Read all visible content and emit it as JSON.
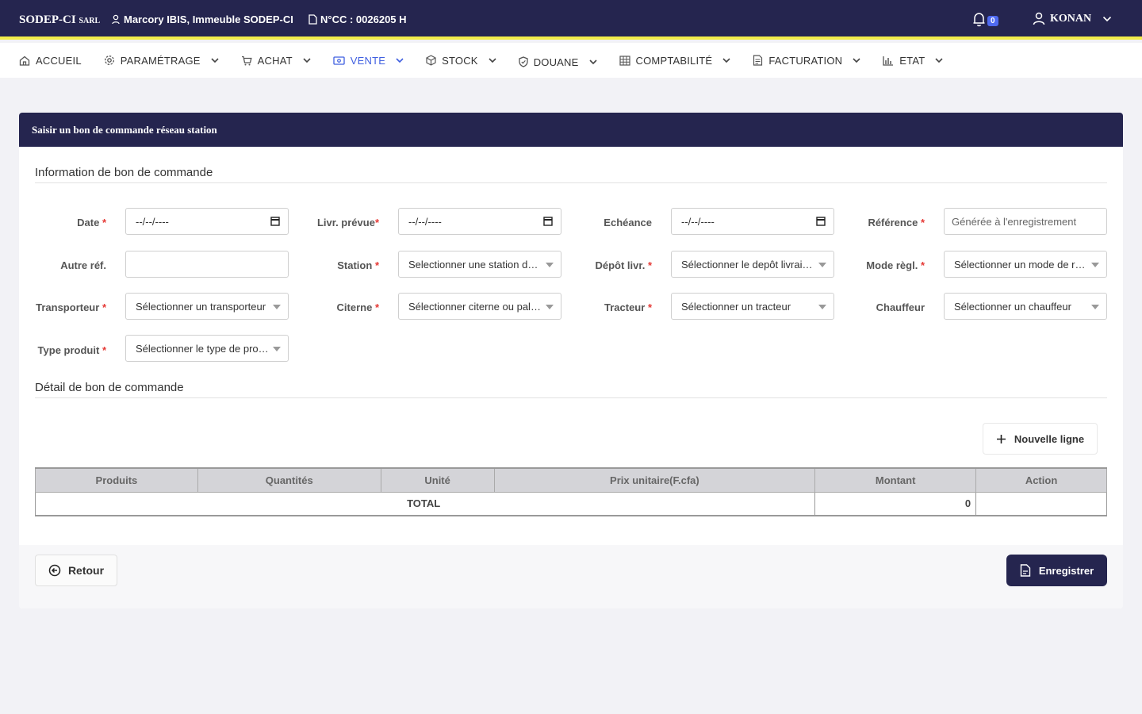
{
  "topbar": {
    "brand": "SODEP-CI",
    "brand_suffix": "SARL",
    "address": "Marcory IBIS, Immeuble SODEP-CI",
    "ncc": "N°CC : 0026205 H",
    "notifications_count": "0",
    "user_name": "KONAN"
  },
  "nav": {
    "items": [
      {
        "label": "ACCUEIL",
        "icon": "home-icon"
      },
      {
        "label": "PARAMÉTRAGE",
        "icon": "gear-icon"
      },
      {
        "label": "ACHAT",
        "icon": "cart-icon"
      },
      {
        "label": "VENTE",
        "icon": "cash-icon"
      },
      {
        "label": "STOCK",
        "icon": "box-icon"
      },
      {
        "label": "DOUANE",
        "icon": "shield-icon"
      },
      {
        "label": "COMPTABILITÉ",
        "icon": "grid-icon"
      },
      {
        "label": "FACTURATION",
        "icon": "invoice-icon"
      },
      {
        "label": "ETAT",
        "icon": "bar-chart-icon"
      }
    ]
  },
  "card": {
    "title": "Saisir un bon de commande réseau station",
    "info_title": "Information de bon de commande",
    "detail_title": "Détail de bon de commande"
  },
  "form": {
    "date_label": "Date",
    "livr_prevue_label": "Livr. prévue",
    "echeance_label": "Echéance",
    "reference_label": "Référence",
    "autre_ref_label": "Autre réf.",
    "station_label": "Station",
    "depot_label": "Dépôt livr.",
    "mode_regl_label": "Mode règl.",
    "transporteur_label": "Transporteur",
    "citerne_label": "Citerne",
    "tracteur_label": "Tracteur",
    "chauffeur_label": "Chauffeur",
    "type_produit_label": "Type produit",
    "required_mark": "*",
    "date_value": "--/--/----",
    "livr_prevue_value": "--/--/----",
    "echeance_value": "--/--/----",
    "reference_placeholder": "Générée à l'enregistrement",
    "autre_ref_value": "",
    "station_select": "Selectionner une station de service",
    "depot_select": "Sélectionner le depôt livraison",
    "mode_regl_select": "Sélectionner un mode de règlement",
    "transporteur_select": "Sélectionner un transporteur",
    "citerne_select": "Sélectionner citerne ou palette",
    "tracteur_select": "Sélectionner un tracteur",
    "chauffeur_select": "Sélectionner un chauffeur",
    "type_produit_select": "Sélectionner le type de produit"
  },
  "detail": {
    "new_line_label": "Nouvelle ligne",
    "columns": [
      "Produits",
      "Quantités",
      "Unité",
      "Prix unitaire(F.cfa)",
      "Montant",
      "Action"
    ],
    "total_label": "TOTAL",
    "total_value": "0"
  },
  "footer": {
    "back_label": "Retour",
    "save_label": "Enregistrer"
  },
  "colors": {
    "primary": "#25254f",
    "accent": "#3f5fe0",
    "highlight": "#f2ec4a",
    "required": "#e53935"
  }
}
